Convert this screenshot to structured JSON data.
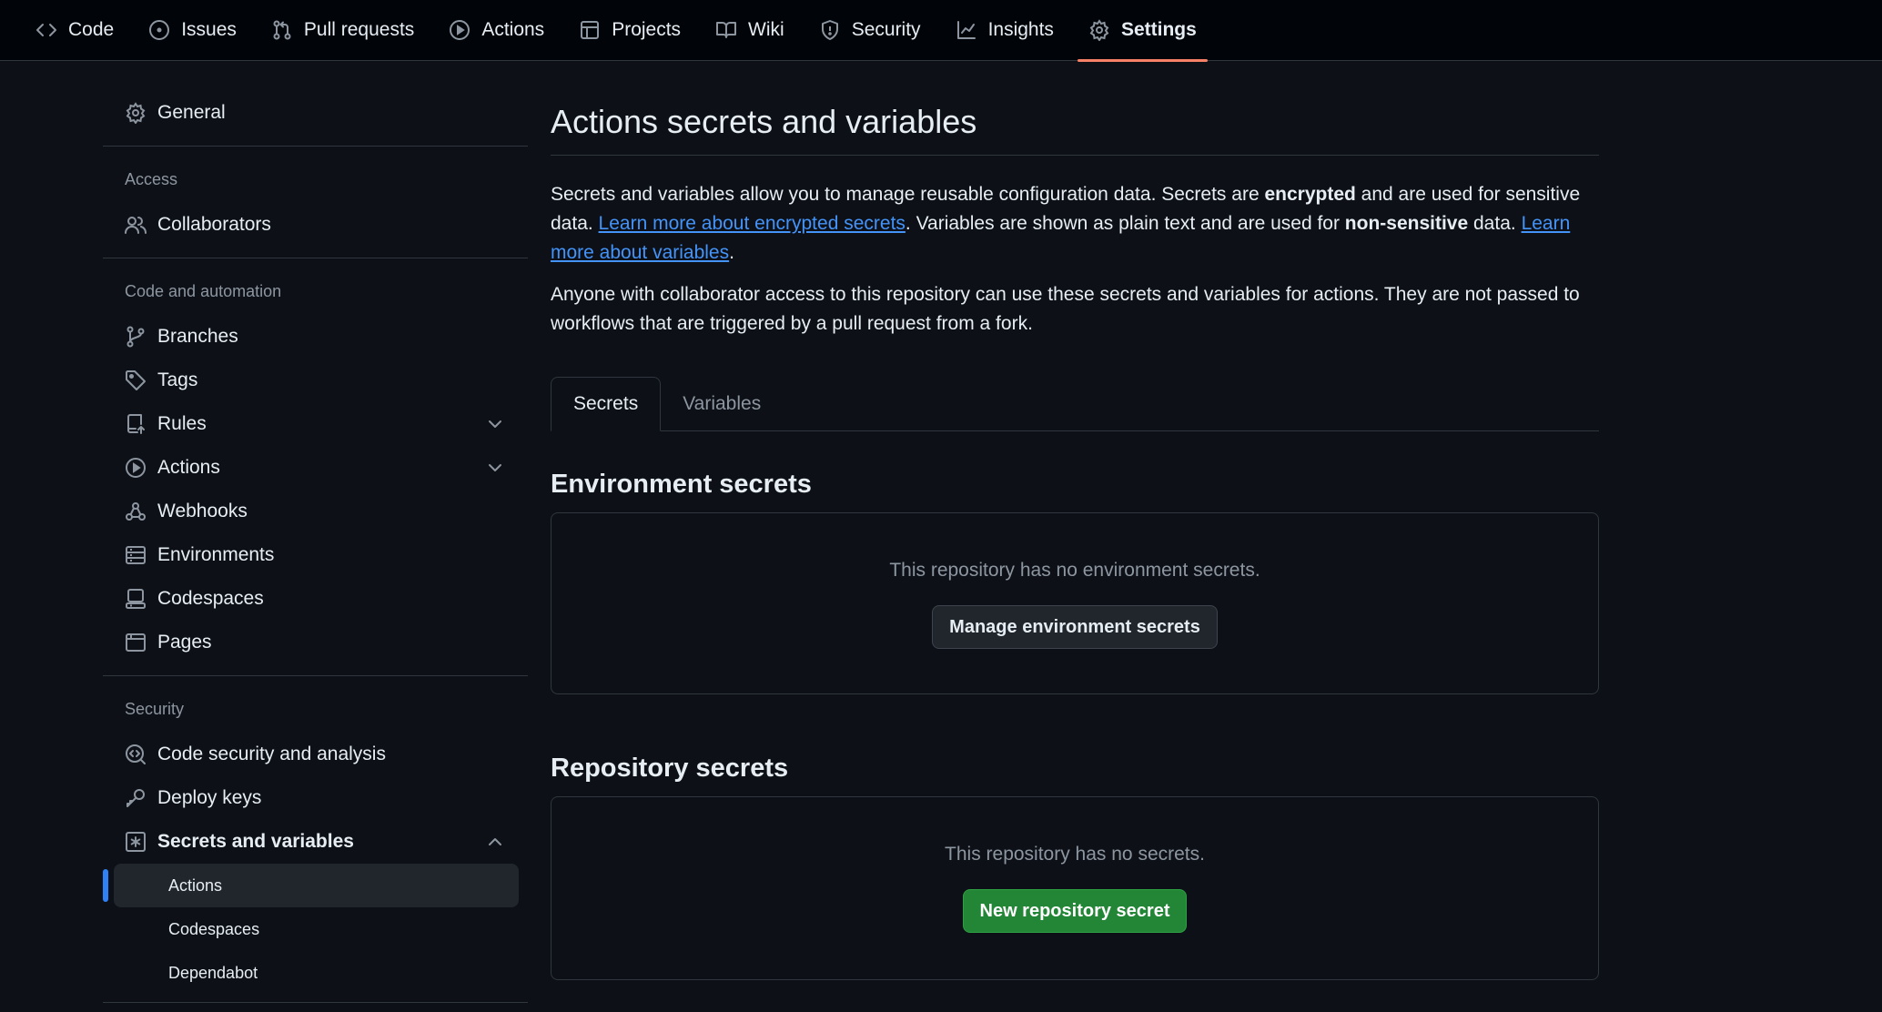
{
  "nav": {
    "tabs": [
      {
        "label": "Code",
        "icon": "code-icon"
      },
      {
        "label": "Issues",
        "icon": "issue-opened-icon"
      },
      {
        "label": "Pull requests",
        "icon": "git-pull-request-icon"
      },
      {
        "label": "Actions",
        "icon": "play-icon"
      },
      {
        "label": "Projects",
        "icon": "table-icon"
      },
      {
        "label": "Wiki",
        "icon": "book-icon"
      },
      {
        "label": "Security",
        "icon": "shield-icon"
      },
      {
        "label": "Insights",
        "icon": "graph-icon"
      },
      {
        "label": "Settings",
        "icon": "gear-icon",
        "active": true
      }
    ],
    "active_color": "#f78166"
  },
  "sidebar": {
    "general": "General",
    "access_heading": "Access",
    "collaborators": "Collaborators",
    "code_heading": "Code and automation",
    "branches": "Branches",
    "tags": "Tags",
    "rules": "Rules",
    "actions": "Actions",
    "webhooks": "Webhooks",
    "environments": "Environments",
    "codespaces": "Codespaces",
    "pages": "Pages",
    "security_heading": "Security",
    "code_security": "Code security and analysis",
    "deploy_keys": "Deploy keys",
    "secrets_variables": "Secrets and variables",
    "sub_actions": "Actions",
    "sub_codespaces": "Codespaces",
    "sub_dependabot": "Dependabot"
  },
  "main": {
    "title": "Actions secrets and variables",
    "desc": {
      "p1_a": "Secrets and variables allow you to manage reusable configuration data. Secrets are ",
      "p1_b": "encrypted",
      "p1_c": " and are used for sensitive data. ",
      "p1_link1": "Learn more about encrypted secrets",
      "p1_d": ". Variables are shown as plain text and are used for ",
      "p1_e": "non-sensitive",
      "p1_f": " data. ",
      "p1_link2": "Learn more about variables",
      "p1_g": ".",
      "p2": "Anyone with collaborator access to this repository can use these secrets and variables for actions. They are not passed to workflows that are triggered by a pull request from a fork."
    },
    "tabs": {
      "secrets": "Secrets",
      "variables": "Variables"
    },
    "env": {
      "title": "Environment secrets",
      "empty": "This repository has no environment secrets.",
      "button": "Manage environment secrets"
    },
    "repo": {
      "title": "Repository secrets",
      "empty": "This repository has no secrets.",
      "button": "New repository secret"
    }
  },
  "colors": {
    "link": "#4493f8",
    "primary": "#238636",
    "selected_marker": "#2f81f7"
  }
}
